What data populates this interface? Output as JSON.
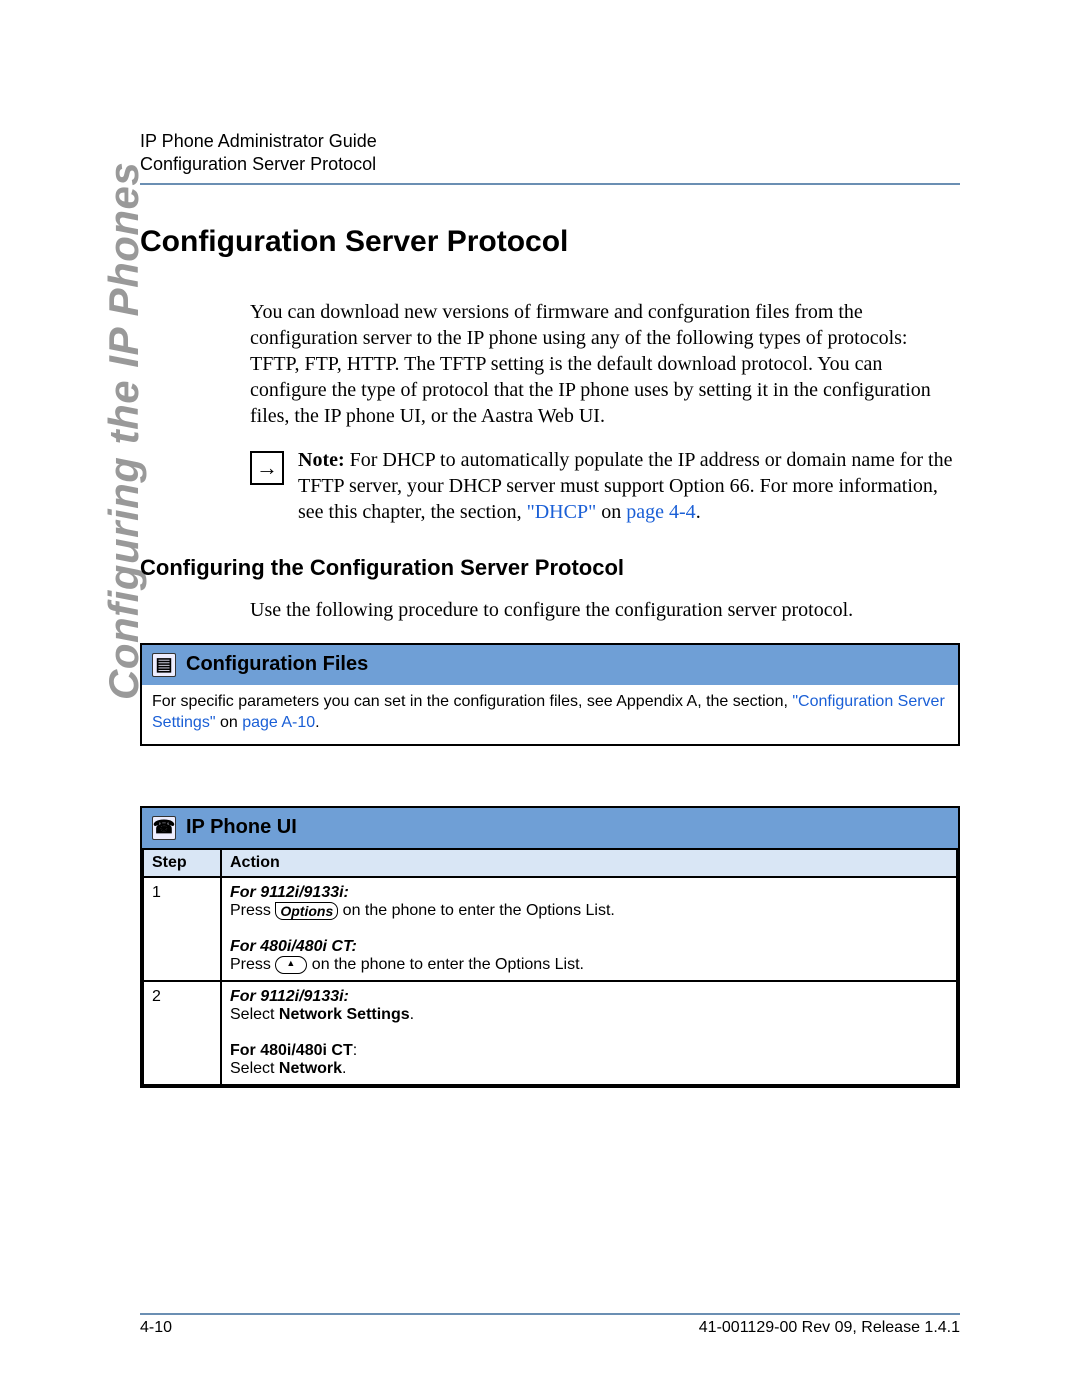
{
  "header": {
    "line1": "IP Phone Administrator Guide",
    "line2": "Configuration Server Protocol"
  },
  "side_title": "Configuring the IP Phones",
  "title": "Configuration Server Protocol",
  "intro": "You can download new versions of firmware and confguration files from the configuration server to the IP phone using any of the following types of protocols: TFTP, FTP, HTTP. The TFTP setting is the default download protocol. You can configure the type of protocol that the IP phone uses by setting it in the configuration files, the IP phone UI, or the Aastra Web UI.",
  "note": {
    "label": "Note:",
    "body": " For DHCP to automatically populate the IP address or domain name for the TFTP server, your DHCP server must support Option 66. For more information, see this chapter, the section, ",
    "link_text": "\"DHCP\"",
    "after_link": " on ",
    "page_link": "page 4-4",
    "period": "."
  },
  "subheading": "Configuring the Configuration Server Protocol",
  "sub_body": "Use the following procedure to configure the configuration server protocol.",
  "config_files": {
    "title": "Configuration Files",
    "body_pre": "For specific parameters you can set in the configuration files, see Appendix A, the section, ",
    "link1": "\"Configuration Server Settings\"",
    "mid": " on ",
    "link2": "page A-10",
    "end": "."
  },
  "phone_ui": {
    "title": "IP Phone UI",
    "col1": "Step",
    "col2": "Action",
    "rows": [
      {
        "num": "1",
        "a_label": "For 9112i/9133i:",
        "a_pre": "Press ",
        "a_key": "Options",
        "a_post": " on the phone to enter the Options List.",
        "b_label": "For 480i/480i CT:",
        "b_pre": "Press ",
        "b_post": " on the phone to enter the Options List."
      },
      {
        "num": "2",
        "a_label": "For 9112i/9133i:",
        "a_pre": "Select ",
        "a_bold": "Network Settings",
        "a_post": ".",
        "b_label": "For 480i/480i CT",
        "b_colon": ":",
        "b_pre": "Select ",
        "b_bold": "Network",
        "b_post": "."
      }
    ]
  },
  "footer": {
    "left": "4-10",
    "right": "41-001129-00 Rev 09, Release 1.4.1"
  }
}
